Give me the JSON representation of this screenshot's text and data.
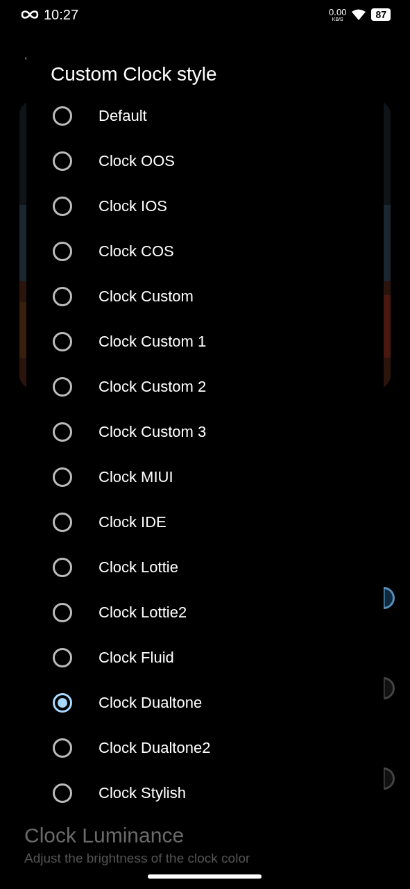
{
  "status_bar": {
    "time": "10:27",
    "net_speed": "0.00",
    "net_unit": "KB/S",
    "battery": "87"
  },
  "background": {
    "section_title": "Clock Luminance",
    "section_subtitle": "Adjust the brightness of the clock color",
    "toggles": [
      {
        "on": true
      },
      {
        "on": false
      },
      {
        "on": false
      }
    ]
  },
  "dialog": {
    "title": "Custom Clock style",
    "options": [
      {
        "label": "Default",
        "selected": false
      },
      {
        "label": "Clock OOS",
        "selected": false
      },
      {
        "label": "Clock IOS",
        "selected": false
      },
      {
        "label": "Clock COS",
        "selected": false
      },
      {
        "label": "Clock Custom",
        "selected": false
      },
      {
        "label": "Clock Custom 1",
        "selected": false
      },
      {
        "label": "Clock Custom 2",
        "selected": false
      },
      {
        "label": "Clock Custom 3",
        "selected": false
      },
      {
        "label": "Clock MIUI",
        "selected": false
      },
      {
        "label": "Clock IDE",
        "selected": false
      },
      {
        "label": "Clock Lottie",
        "selected": false
      },
      {
        "label": "Clock Lottie2",
        "selected": false
      },
      {
        "label": "Clock Fluid",
        "selected": false
      },
      {
        "label": "Clock Dualtone",
        "selected": true
      },
      {
        "label": "Clock Dualtone2",
        "selected": false
      },
      {
        "label": "Clock Stylish",
        "selected": false
      }
    ]
  }
}
